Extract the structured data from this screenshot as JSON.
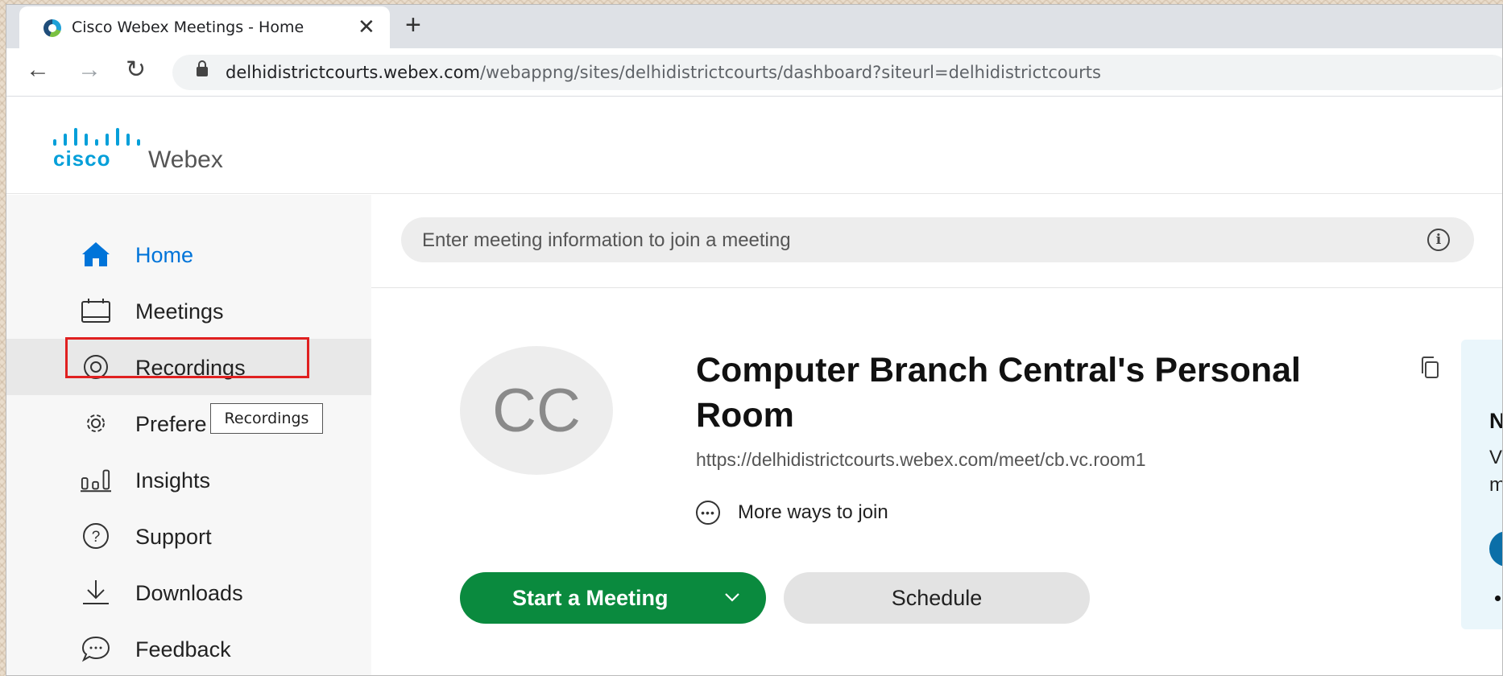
{
  "browser": {
    "tab_title": "Cisco Webex Meetings - Home",
    "tab_close": "✕",
    "new_tab": "+",
    "url_domain": "delhidistrictcourts.webex.com",
    "url_path": "/webappng/sites/delhidistrictcourts/dashboard?siteurl=delhidistrictcourts"
  },
  "header": {
    "cisco_label": "cisco",
    "product_label": "Webex"
  },
  "sidebar": {
    "items": [
      {
        "label": "Home",
        "icon": "home-icon"
      },
      {
        "label": "Meetings",
        "icon": "calendar-icon"
      },
      {
        "label": "Recordings",
        "icon": "recording-icon"
      },
      {
        "label": "Prefere",
        "icon": "gear-icon"
      },
      {
        "label": "Insights",
        "icon": "insights-icon"
      },
      {
        "label": "Support",
        "icon": "help-icon"
      },
      {
        "label": "Downloads",
        "icon": "download-icon"
      },
      {
        "label": "Feedback",
        "icon": "feedback-icon"
      }
    ],
    "tooltip": "Recordings"
  },
  "main": {
    "join_placeholder": "Enter meeting information to join a meeting",
    "avatar_initials": "CC",
    "room_title": "Computer Branch Central's Personal Room",
    "room_url": "https://delhidistrictcourts.webex.com/meet/cb.vc.room1",
    "more_ways": "More ways to join",
    "start_button": "Start a Meeting",
    "schedule_button": "Schedule"
  },
  "right_panel": {
    "heading": "N",
    "line1": "Vi",
    "line2": "m"
  },
  "colors": {
    "accent_blue": "#049fd9",
    "active_nav": "#0074d9",
    "start_green": "#0a8a3e",
    "highlight_red": "#e02020"
  }
}
